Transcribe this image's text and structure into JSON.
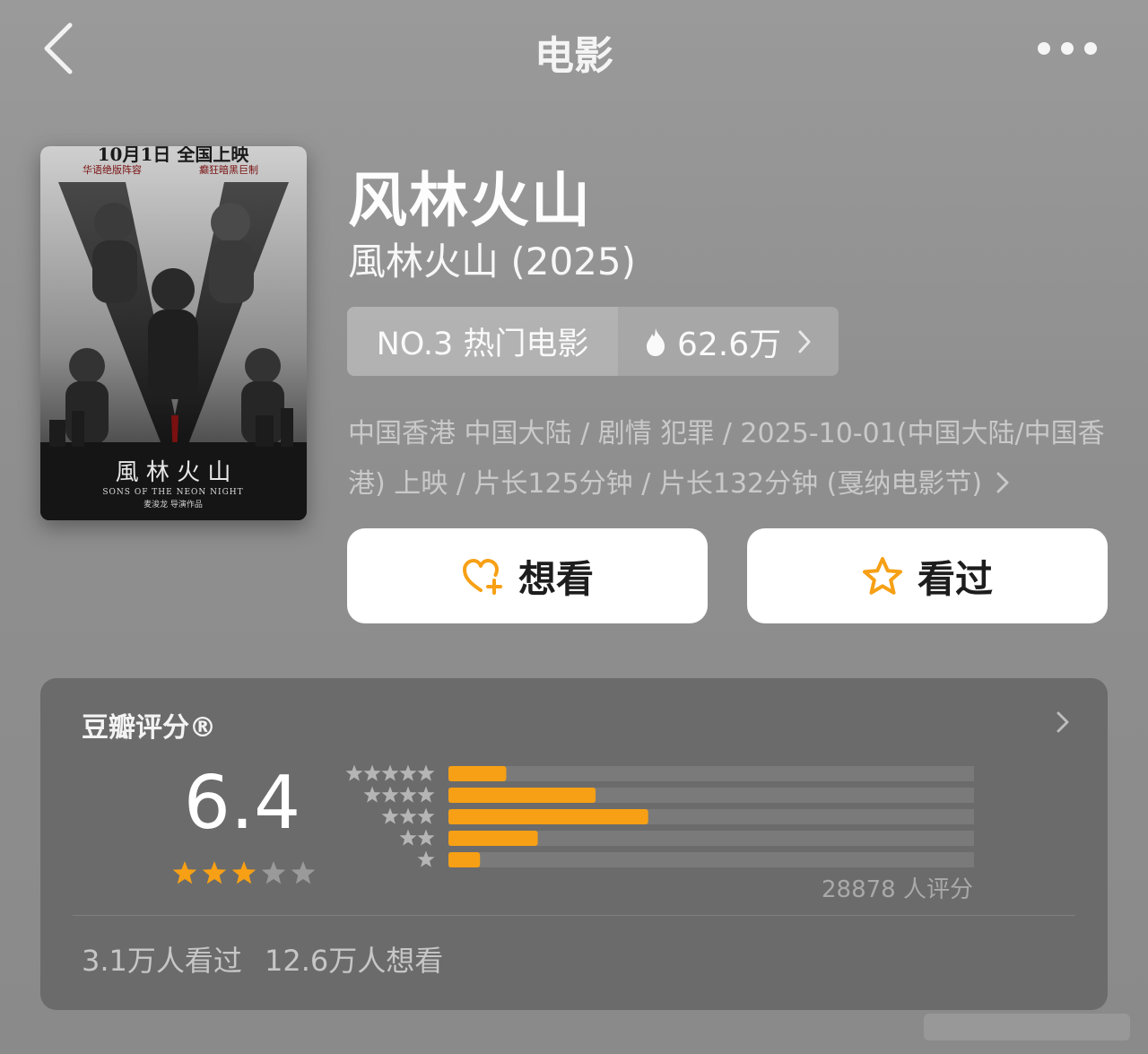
{
  "nav": {
    "title": "电影",
    "back_icon": "chevron-left-icon",
    "more_icon": "ellipsis-icon"
  },
  "poster": {
    "top_line": "10月1日 全国上映",
    "tagline_left": "华语绝版阵容",
    "tagline_right": "癫狂暗黑巨制",
    "title_cn": "風 林 火 山",
    "title_en": "SONS OF THE NEON NIGHT",
    "director": "麦浚龙 导演作品"
  },
  "movie": {
    "title": "风林火山",
    "original_title": "風林火山 (2025)",
    "rank_label": "NO.3 热门电影",
    "heat_value": "62.6万",
    "meta": "中国香港 中国大陆 / 剧情 犯罪 / 2025-10-01(中国大陆/中国香港) 上映 / 片长125分钟 / 片长132分钟 (戛纳电影节)"
  },
  "actions": {
    "want_label": "想看",
    "seen_label": "看过"
  },
  "rating": {
    "title": "豆瓣评分®",
    "score": "6.4",
    "stars_filled": 3,
    "stars_total": 5,
    "distribution": [
      {
        "stars": 5,
        "fraction": 0.11
      },
      {
        "stars": 4,
        "fraction": 0.28
      },
      {
        "stars": 3,
        "fraction": 0.38
      },
      {
        "stars": 2,
        "fraction": 0.17
      },
      {
        "stars": 1,
        "fraction": 0.06
      }
    ],
    "count_text": "28878 人评分",
    "seen_text": "3.1万人看过",
    "want_text": "12.6万人想看"
  },
  "colors": {
    "accent": "#f7a015",
    "card_bg": "#6b6b6b",
    "bar_track": "#7a7a7a",
    "text_primary": "#ffffff",
    "text_muted": "#c9c9c9"
  }
}
